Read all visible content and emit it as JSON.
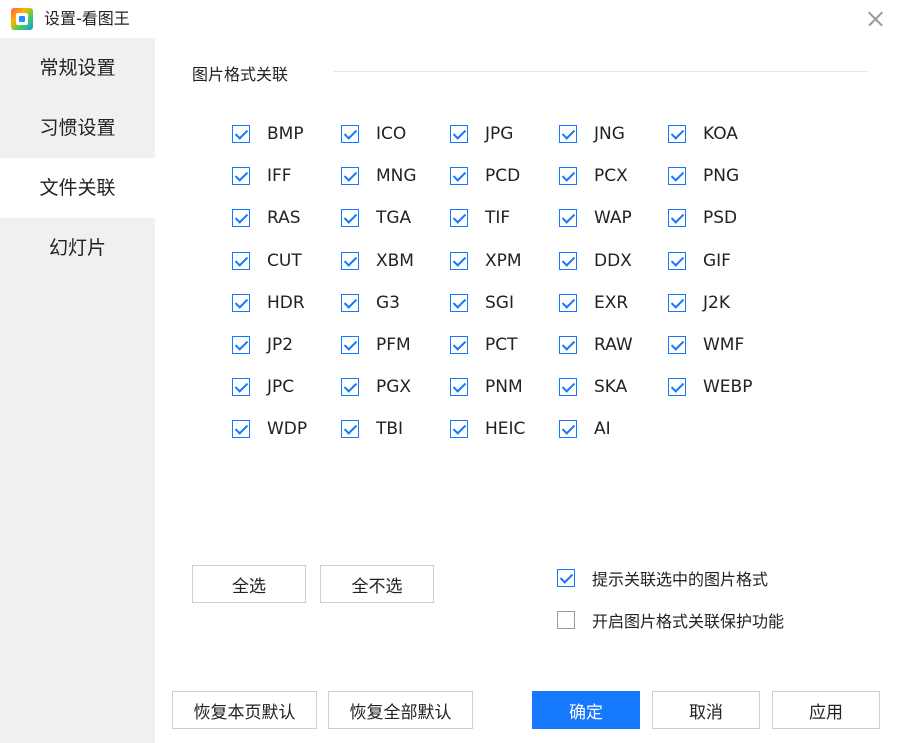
{
  "window": {
    "title": "设置-看图王"
  },
  "sidebar": {
    "items": [
      {
        "label": "常规设置",
        "active": false
      },
      {
        "label": "习惯设置",
        "active": false
      },
      {
        "label": "文件关联",
        "active": true
      },
      {
        "label": "幻灯片",
        "active": false
      }
    ]
  },
  "section": {
    "title": "图片格式关联"
  },
  "formats": [
    {
      "label": "BMP",
      "checked": true
    },
    {
      "label": "ICO",
      "checked": true
    },
    {
      "label": "JPG",
      "checked": true
    },
    {
      "label": "JNG",
      "checked": true
    },
    {
      "label": "KOA",
      "checked": true
    },
    {
      "label": "IFF",
      "checked": true
    },
    {
      "label": "MNG",
      "checked": true
    },
    {
      "label": "PCD",
      "checked": true
    },
    {
      "label": "PCX",
      "checked": true
    },
    {
      "label": "PNG",
      "checked": true
    },
    {
      "label": "RAS",
      "checked": true
    },
    {
      "label": "TGA",
      "checked": true
    },
    {
      "label": "TIF",
      "checked": true
    },
    {
      "label": "WAP",
      "checked": true
    },
    {
      "label": "PSD",
      "checked": true
    },
    {
      "label": "CUT",
      "checked": true
    },
    {
      "label": "XBM",
      "checked": true
    },
    {
      "label": "XPM",
      "checked": true
    },
    {
      "label": "DDX",
      "checked": true
    },
    {
      "label": "GIF",
      "checked": true
    },
    {
      "label": "HDR",
      "checked": true
    },
    {
      "label": "G3",
      "checked": true
    },
    {
      "label": "SGI",
      "checked": true
    },
    {
      "label": "EXR",
      "checked": true
    },
    {
      "label": "J2K",
      "checked": true
    },
    {
      "label": "JP2",
      "checked": true
    },
    {
      "label": "PFM",
      "checked": true
    },
    {
      "label": "PCT",
      "checked": true
    },
    {
      "label": "RAW",
      "checked": true
    },
    {
      "label": "WMF",
      "checked": true
    },
    {
      "label": "JPC",
      "checked": true
    },
    {
      "label": "PGX",
      "checked": true
    },
    {
      "label": "PNM",
      "checked": true
    },
    {
      "label": "SKA",
      "checked": true
    },
    {
      "label": "WEBP",
      "checked": true
    },
    {
      "label": "WDP",
      "checked": true
    },
    {
      "label": "TBI",
      "checked": true
    },
    {
      "label": "HEIC",
      "checked": true
    },
    {
      "label": "AI",
      "checked": true
    }
  ],
  "selection": {
    "select_all": "全选",
    "select_none": "全不选"
  },
  "options": {
    "prompt_associate": {
      "label": "提示关联选中的图片格式",
      "checked": true
    },
    "protect_association": {
      "label": "开启图片格式关联保护功能",
      "checked": false
    }
  },
  "footer": {
    "restore_page": "恢复本页默认",
    "restore_all": "恢复全部默认",
    "ok": "确定",
    "cancel": "取消",
    "apply": "应用"
  },
  "colors": {
    "accent": "#1677ff",
    "sidebar_bg": "#f0f0f0",
    "border": "#cfcfcf"
  }
}
